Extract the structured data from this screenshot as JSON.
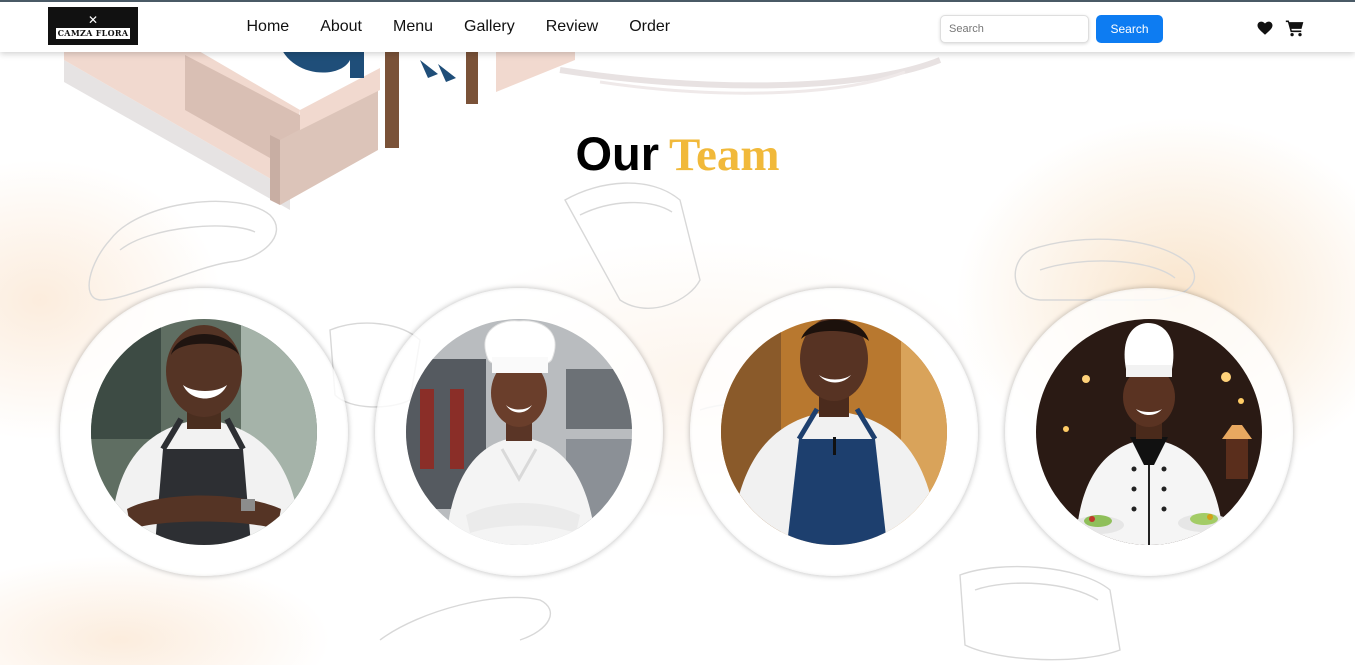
{
  "navbar": {
    "logo_text": "CAMZA FLORA",
    "links": [
      "Home",
      "About",
      "Menu",
      "Gallery",
      "Review",
      "Order"
    ],
    "search": {
      "placeholder": "Search",
      "value": "",
      "button_label": "Search"
    },
    "icons": [
      "heart-icon",
      "cart-icon"
    ]
  },
  "team_section": {
    "title_part1": "Our",
    "title_part2": "Team",
    "title_accent_color": "#f1b93a",
    "members": [
      {
        "photo": "smiling chef in dark apron, arms crossed"
      },
      {
        "photo": "chef in white toque, arms crossed"
      },
      {
        "photo": "cook in blue apron"
      },
      {
        "photo": "head chef in toque holding plates"
      }
    ]
  },
  "colors": {
    "primary_button": "#0d7cf2",
    "accent": "#f1b93a",
    "text": "#111111"
  }
}
